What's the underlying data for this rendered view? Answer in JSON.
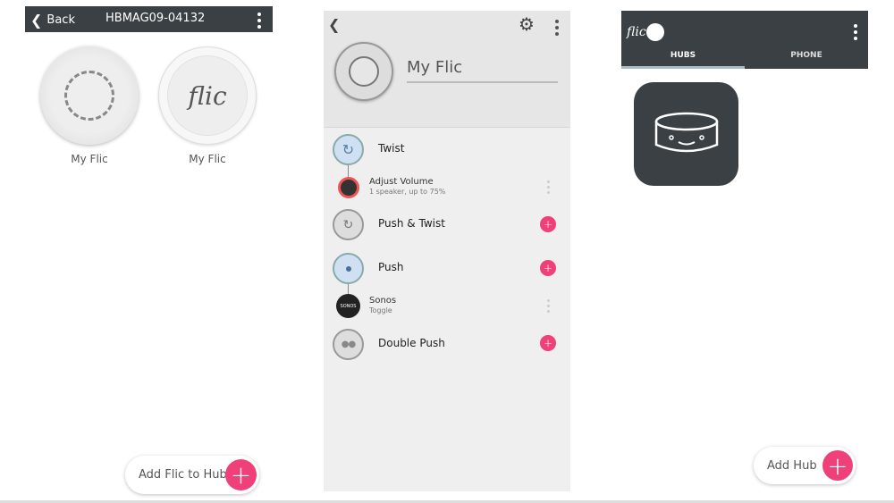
{
  "hub_screen": {
    "back_label": "Back",
    "title": "HBMAG09-04132",
    "buttons": [
      {
        "label": "My Flic",
        "type": "twist"
      },
      {
        "label": "My Flic",
        "type": "classic",
        "logo": "flic"
      }
    ],
    "add_label": "Add Flic to Hub"
  },
  "button_screen": {
    "name": "My Flic",
    "triggers": [
      {
        "label": "Twist",
        "action": {
          "title": "Adjust Volume",
          "subtitle": "1 speaker, up to 75%"
        }
      },
      {
        "label": "Push & Twist"
      },
      {
        "label": "Push",
        "action": {
          "title": "Sonos",
          "subtitle": "Toggle",
          "logo": "SONOS"
        }
      },
      {
        "label": "Double Push"
      }
    ]
  },
  "hubs_screen": {
    "logo": "flic",
    "tabs": [
      {
        "label": "HUBS",
        "active": true
      },
      {
        "label": "PHONE",
        "active": false
      }
    ],
    "add_label": "Add Hub"
  },
  "colors": {
    "header": "#3a4044",
    "accent": "#f0407a",
    "active_trigger": "#cfe0f2"
  }
}
